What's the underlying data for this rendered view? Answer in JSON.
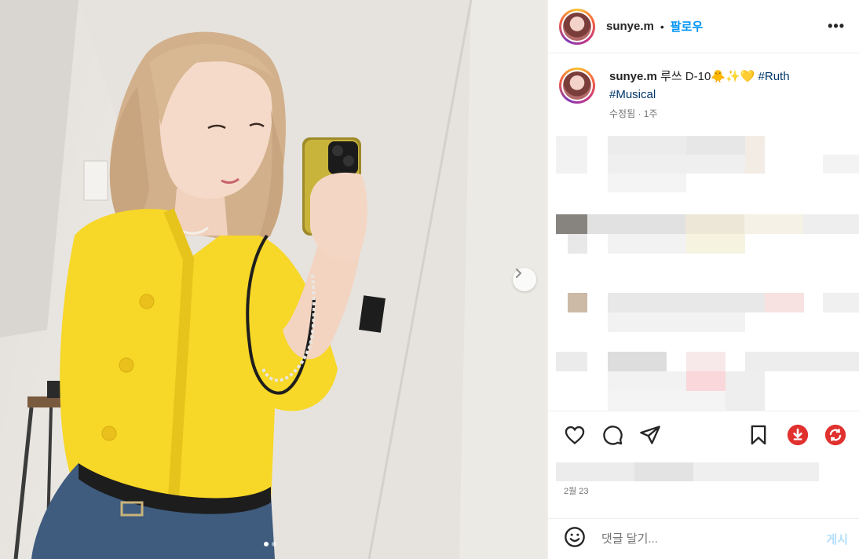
{
  "post": {
    "username": "sunye.m",
    "separator": "•",
    "follow_label": "팔로우",
    "more_label": "•••"
  },
  "caption": {
    "username": "sunye.m",
    "text": "루쓰 D-10🐥✨💛",
    "hashtags": [
      "#Ruth",
      "#Musical"
    ],
    "meta": "수정됨 · 1주"
  },
  "actions": {
    "like_icon": "heart-icon",
    "comment_icon": "comment-icon",
    "share_icon": "send-icon",
    "save_icon": "bookmark-icon",
    "download_icon": "download-icon",
    "repost_icon": "repost-icon",
    "accent_red": "#e0312f"
  },
  "date_label": "2월 23",
  "comment_box": {
    "emoji_icon": "emoji-icon",
    "placeholder": "댓글 달기...",
    "post_label": "게시"
  },
  "carousel": {
    "next_icon": "chevron-right-icon",
    "slide_count": 2,
    "active_slide": 1
  }
}
